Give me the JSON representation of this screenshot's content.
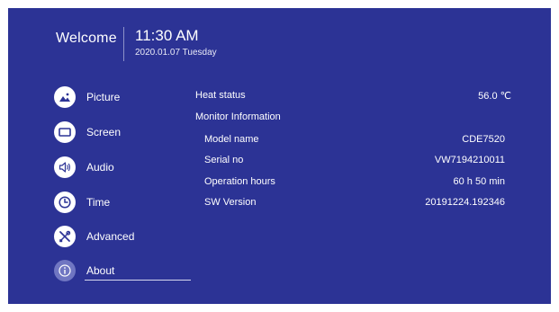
{
  "header": {
    "welcome": "Welcome",
    "time": "11:30 AM",
    "date": "2020.01.07 Tuesday"
  },
  "menu": {
    "items": [
      {
        "label": "Picture",
        "icon": "picture-icon"
      },
      {
        "label": "Screen",
        "icon": "screen-icon"
      },
      {
        "label": "Audio",
        "icon": "audio-icon"
      },
      {
        "label": "Time",
        "icon": "clock-icon"
      },
      {
        "label": "Advanced",
        "icon": "tools-icon"
      },
      {
        "label": "About",
        "icon": "info-icon",
        "active": true
      }
    ]
  },
  "about": {
    "heat_status": {
      "label": "Heat status",
      "value": "56.0 ℃"
    },
    "monitor_info_heading": "Monitor Information",
    "model_name": {
      "label": "Model name",
      "value": "CDE7520"
    },
    "serial_no": {
      "label": "Serial no",
      "value": "VW7194210011"
    },
    "operation_hours": {
      "label": "Operation hours",
      "value": "60 h 50 min"
    },
    "sw_version": {
      "label": "SW Version",
      "value": "20191224.192346"
    }
  },
  "colors": {
    "background": "#2c3395",
    "active_icon": "#7076c2",
    "text": "#ffffff"
  }
}
